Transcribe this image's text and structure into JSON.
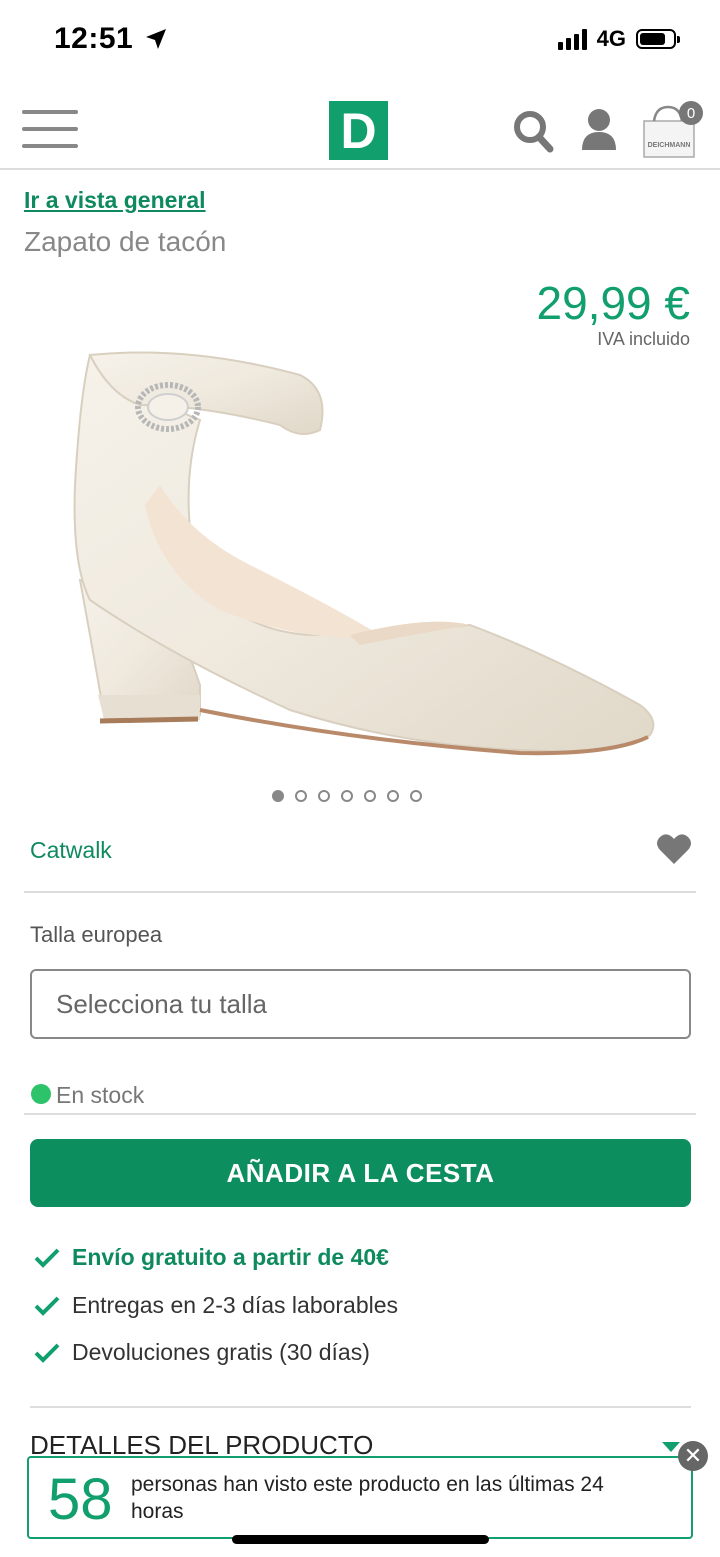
{
  "status_bar": {
    "time": "12:51",
    "network": "4G"
  },
  "header": {
    "logo_letter": "D",
    "cart_count": "0",
    "bag_brand": "DEICHMANN"
  },
  "product": {
    "overview_link": "Ir a vista general",
    "title": "Zapato de tacón",
    "price": "29,99 €",
    "vat_note": "IVA incluido",
    "image_count": 7,
    "active_image": 1,
    "brand": "Catwalk"
  },
  "size": {
    "label": "Talla europea",
    "placeholder": "Selecciona tu talla"
  },
  "stock": {
    "text": "En stock",
    "color": "#2cc36b"
  },
  "cart_button": {
    "label": "AÑADIR A LA CESTA"
  },
  "benefits": [
    "Envío gratuito a partir de 40€",
    "Entregas en 2-3 días laborables",
    "Devoluciones gratis (30 días)"
  ],
  "details": {
    "label": "DETALLES DEL PRODUCTO"
  },
  "popup": {
    "count": "58",
    "text": "personas han visto este producto en las últimas 24 horas"
  },
  "colors": {
    "brand_green": "#109f6d",
    "button_green": "#0c8e5e"
  }
}
